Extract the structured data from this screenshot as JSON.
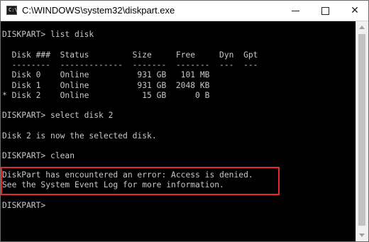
{
  "window": {
    "title": "C:\\WINDOWS\\system32\\diskpart.exe",
    "icon": "console-app-icon",
    "icon_glyph": "C:\\",
    "controls": {
      "minimize": "minimize-icon",
      "maximize": "maximize-icon",
      "close_glyph": "✕"
    }
  },
  "console": {
    "lines": [
      "DISKPART> list disk",
      "",
      "  Disk ###  Status         Size     Free     Dyn  Gpt",
      "  --------  -------------  -------  -------  ---  ---",
      "  Disk 0    Online          931 GB   101 MB",
      "  Disk 1    Online          931 GB  2048 KB",
      "* Disk 2    Online           15 GB      0 B",
      "",
      "DISKPART> select disk 2",
      "",
      "Disk 2 is now the selected disk.",
      "",
      "DISKPART> clean",
      "",
      "DiskPart has encountered an error: Access is denied.",
      "See the System Event Log for more information.",
      "",
      "DISKPART>"
    ]
  },
  "colors": {
    "console_bg": "#000000",
    "console_text": "#c8c8c8",
    "highlight_border": "#e8262c"
  }
}
